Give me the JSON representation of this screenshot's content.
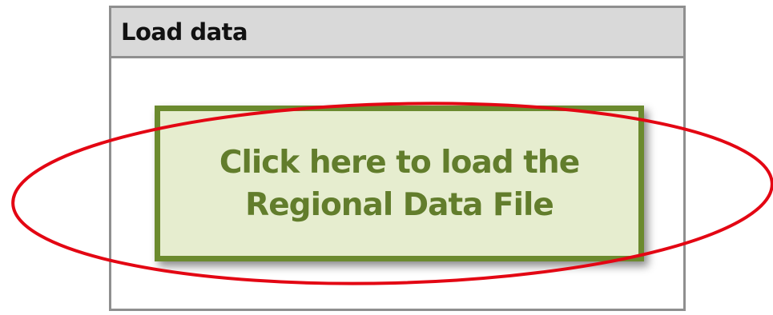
{
  "panel": {
    "title": "Load data"
  },
  "load_button": {
    "line1": "Click here to load the",
    "line2": "Regional Data File"
  },
  "colors": {
    "header_bg": "#d9d9d9",
    "panel_border": "#8f8f8f",
    "button_fill": "#e6edcf",
    "button_border": "#6b8a2e",
    "button_text": "#627d2c",
    "highlight_ring": "#e30613"
  }
}
